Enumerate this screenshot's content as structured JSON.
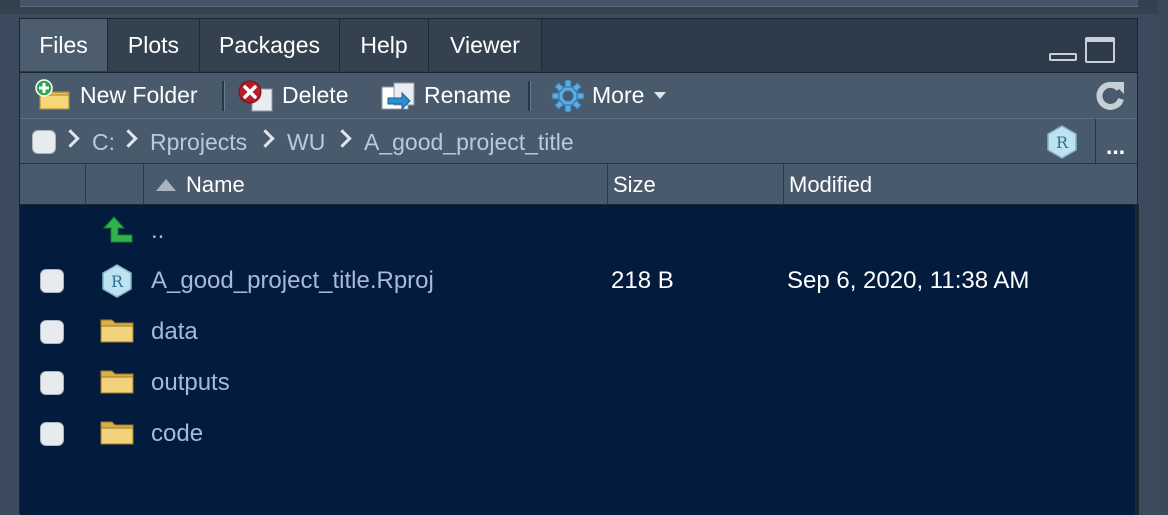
{
  "tabs": [
    "Files",
    "Plots",
    "Packages",
    "Help",
    "Viewer"
  ],
  "toolbar": {
    "new_folder": "New Folder",
    "delete": "Delete",
    "rename": "Rename",
    "more": "More"
  },
  "breadcrumb": [
    "C:",
    "Rprojects",
    "WU",
    "A_good_project_title"
  ],
  "breadcrumb_overflow": "...",
  "columns": {
    "name": "Name",
    "size": "Size",
    "modified": "Modified"
  },
  "parent_dir": "..",
  "files": [
    {
      "name": "A_good_project_title.Rproj",
      "size": "218 B",
      "modified": "Sep 6, 2020, 11:38 AM",
      "type": "rproj"
    },
    {
      "name": "data",
      "size": "",
      "modified": "",
      "type": "folder"
    },
    {
      "name": "outputs",
      "size": "",
      "modified": "",
      "type": "folder"
    },
    {
      "name": "code",
      "size": "",
      "modified": "",
      "type": "folder"
    }
  ],
  "colors": {
    "list_bg": "#031c3e",
    "link_text": "#a8b8de",
    "toolbar_bg": "#4a5a6d"
  },
  "icons": [
    "new-folder-icon",
    "delete-icon",
    "rename-icon",
    "gear-icon",
    "refresh-icon",
    "r-project-icon",
    "up-arrow-icon",
    "folder-icon"
  ]
}
